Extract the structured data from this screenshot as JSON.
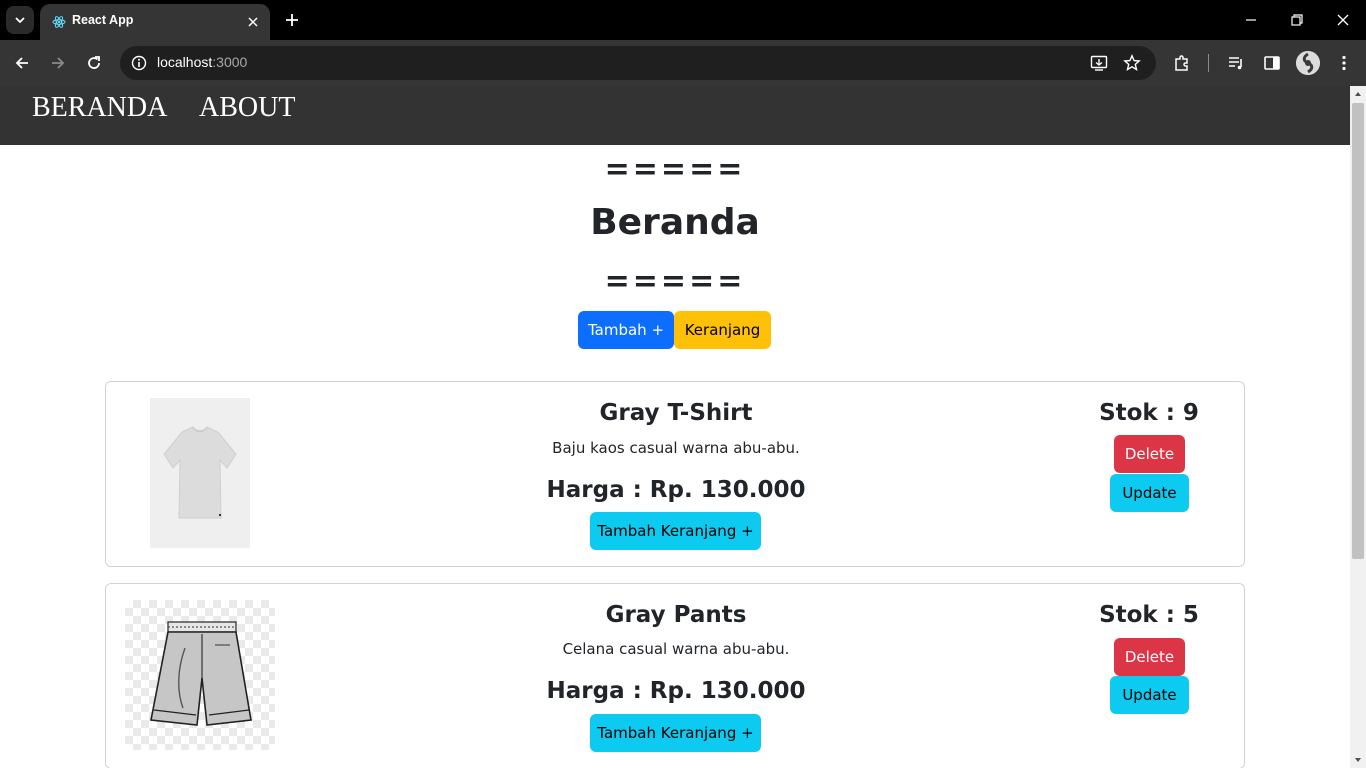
{
  "browser": {
    "tab_title": "React App",
    "url_host": "localhost",
    "url_port": ":3000"
  },
  "nav": {
    "links": [
      "BERANDA",
      "ABOUT"
    ]
  },
  "page": {
    "decoration_top": "=====",
    "title": "Beranda",
    "decoration_bottom": "=====",
    "add_button": "Tambah +",
    "cart_button": "Keranjang"
  },
  "products": [
    {
      "name": "Gray T-Shirt",
      "description": "Baju kaos casual warna abu-abu.",
      "price": "Harga : Rp. 130.000",
      "stock": "Stok : 9",
      "delete_label": "Delete",
      "update_label": "Update",
      "add_cart_label": "Tambah Keranjang +"
    },
    {
      "name": "Gray Pants",
      "description": "Celana casual warna abu-abu.",
      "price": "Harga : Rp. 130.000",
      "stock": "Stok : 5",
      "delete_label": "Delete",
      "update_label": "Update",
      "add_cart_label": "Tambah Keranjang +"
    }
  ],
  "colors": {
    "primary": "#0d6efd",
    "warning": "#ffc107",
    "danger": "#dc3545",
    "info": "#0dcaf0",
    "navbar": "#333333"
  }
}
